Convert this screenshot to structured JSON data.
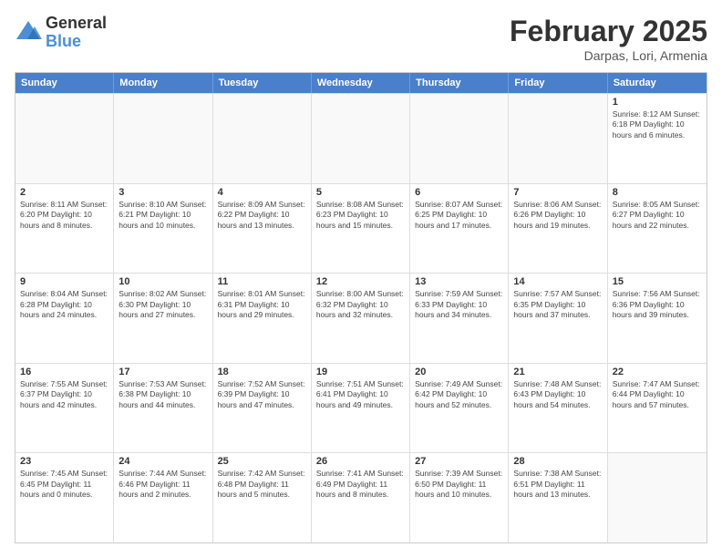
{
  "logo": {
    "general": "General",
    "blue": "Blue"
  },
  "title": {
    "month": "February 2025",
    "location": "Darpas, Lori, Armenia"
  },
  "header_days": [
    "Sunday",
    "Monday",
    "Tuesday",
    "Wednesday",
    "Thursday",
    "Friday",
    "Saturday"
  ],
  "weeks": [
    [
      {
        "day": "",
        "info": "",
        "empty": true
      },
      {
        "day": "",
        "info": "",
        "empty": true
      },
      {
        "day": "",
        "info": "",
        "empty": true
      },
      {
        "day": "",
        "info": "",
        "empty": true
      },
      {
        "day": "",
        "info": "",
        "empty": true
      },
      {
        "day": "",
        "info": "",
        "empty": true
      },
      {
        "day": "1",
        "info": "Sunrise: 8:12 AM\nSunset: 6:18 PM\nDaylight: 10 hours\nand 6 minutes.",
        "empty": false
      }
    ],
    [
      {
        "day": "2",
        "info": "Sunrise: 8:11 AM\nSunset: 6:20 PM\nDaylight: 10 hours\nand 8 minutes.",
        "empty": false
      },
      {
        "day": "3",
        "info": "Sunrise: 8:10 AM\nSunset: 6:21 PM\nDaylight: 10 hours\nand 10 minutes.",
        "empty": false
      },
      {
        "day": "4",
        "info": "Sunrise: 8:09 AM\nSunset: 6:22 PM\nDaylight: 10 hours\nand 13 minutes.",
        "empty": false
      },
      {
        "day": "5",
        "info": "Sunrise: 8:08 AM\nSunset: 6:23 PM\nDaylight: 10 hours\nand 15 minutes.",
        "empty": false
      },
      {
        "day": "6",
        "info": "Sunrise: 8:07 AM\nSunset: 6:25 PM\nDaylight: 10 hours\nand 17 minutes.",
        "empty": false
      },
      {
        "day": "7",
        "info": "Sunrise: 8:06 AM\nSunset: 6:26 PM\nDaylight: 10 hours\nand 19 minutes.",
        "empty": false
      },
      {
        "day": "8",
        "info": "Sunrise: 8:05 AM\nSunset: 6:27 PM\nDaylight: 10 hours\nand 22 minutes.",
        "empty": false
      }
    ],
    [
      {
        "day": "9",
        "info": "Sunrise: 8:04 AM\nSunset: 6:28 PM\nDaylight: 10 hours\nand 24 minutes.",
        "empty": false
      },
      {
        "day": "10",
        "info": "Sunrise: 8:02 AM\nSunset: 6:30 PM\nDaylight: 10 hours\nand 27 minutes.",
        "empty": false
      },
      {
        "day": "11",
        "info": "Sunrise: 8:01 AM\nSunset: 6:31 PM\nDaylight: 10 hours\nand 29 minutes.",
        "empty": false
      },
      {
        "day": "12",
        "info": "Sunrise: 8:00 AM\nSunset: 6:32 PM\nDaylight: 10 hours\nand 32 minutes.",
        "empty": false
      },
      {
        "day": "13",
        "info": "Sunrise: 7:59 AM\nSunset: 6:33 PM\nDaylight: 10 hours\nand 34 minutes.",
        "empty": false
      },
      {
        "day": "14",
        "info": "Sunrise: 7:57 AM\nSunset: 6:35 PM\nDaylight: 10 hours\nand 37 minutes.",
        "empty": false
      },
      {
        "day": "15",
        "info": "Sunrise: 7:56 AM\nSunset: 6:36 PM\nDaylight: 10 hours\nand 39 minutes.",
        "empty": false
      }
    ],
    [
      {
        "day": "16",
        "info": "Sunrise: 7:55 AM\nSunset: 6:37 PM\nDaylight: 10 hours\nand 42 minutes.",
        "empty": false
      },
      {
        "day": "17",
        "info": "Sunrise: 7:53 AM\nSunset: 6:38 PM\nDaylight: 10 hours\nand 44 minutes.",
        "empty": false
      },
      {
        "day": "18",
        "info": "Sunrise: 7:52 AM\nSunset: 6:39 PM\nDaylight: 10 hours\nand 47 minutes.",
        "empty": false
      },
      {
        "day": "19",
        "info": "Sunrise: 7:51 AM\nSunset: 6:41 PM\nDaylight: 10 hours\nand 49 minutes.",
        "empty": false
      },
      {
        "day": "20",
        "info": "Sunrise: 7:49 AM\nSunset: 6:42 PM\nDaylight: 10 hours\nand 52 minutes.",
        "empty": false
      },
      {
        "day": "21",
        "info": "Sunrise: 7:48 AM\nSunset: 6:43 PM\nDaylight: 10 hours\nand 54 minutes.",
        "empty": false
      },
      {
        "day": "22",
        "info": "Sunrise: 7:47 AM\nSunset: 6:44 PM\nDaylight: 10 hours\nand 57 minutes.",
        "empty": false
      }
    ],
    [
      {
        "day": "23",
        "info": "Sunrise: 7:45 AM\nSunset: 6:45 PM\nDaylight: 11 hours\nand 0 minutes.",
        "empty": false
      },
      {
        "day": "24",
        "info": "Sunrise: 7:44 AM\nSunset: 6:46 PM\nDaylight: 11 hours\nand 2 minutes.",
        "empty": false
      },
      {
        "day": "25",
        "info": "Sunrise: 7:42 AM\nSunset: 6:48 PM\nDaylight: 11 hours\nand 5 minutes.",
        "empty": false
      },
      {
        "day": "26",
        "info": "Sunrise: 7:41 AM\nSunset: 6:49 PM\nDaylight: 11 hours\nand 8 minutes.",
        "empty": false
      },
      {
        "day": "27",
        "info": "Sunrise: 7:39 AM\nSunset: 6:50 PM\nDaylight: 11 hours\nand 10 minutes.",
        "empty": false
      },
      {
        "day": "28",
        "info": "Sunrise: 7:38 AM\nSunset: 6:51 PM\nDaylight: 11 hours\nand 13 minutes.",
        "empty": false
      },
      {
        "day": "",
        "info": "",
        "empty": true
      }
    ]
  ]
}
